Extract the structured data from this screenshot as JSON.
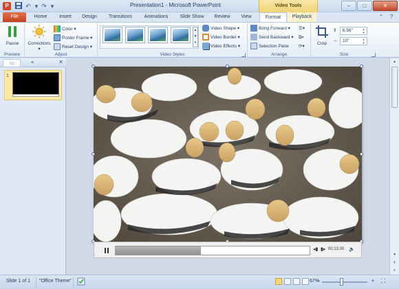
{
  "window": {
    "title": "Presentation1 - Microsoft PowerPoint",
    "context_group": "Video Tools",
    "minimize": "–",
    "maximize": "□",
    "close": "✕"
  },
  "tabs": [
    "File",
    "Home",
    "Insert",
    "Design",
    "Transitions",
    "Animations",
    "Slide Show",
    "Review",
    "View",
    "Format",
    "Playback"
  ],
  "active_tab": "Format",
  "ribbon": {
    "preview": {
      "pause_label": "Pause",
      "group_label": "Preview"
    },
    "adjust": {
      "corrections_label": "Corrections",
      "color_label": "Color",
      "poster_frame_label": "Poster Frame",
      "reset_design_label": "Reset Design",
      "group_label": "Adjust"
    },
    "video_styles": {
      "video_shape_label": "Video Shape",
      "video_border_label": "Video Border",
      "video_effects_label": "Video Effects",
      "group_label": "Video Styles"
    },
    "arrange": {
      "bring_forward_label": "Bring Forward",
      "send_backward_label": "Send Backward",
      "selection_pane_label": "Selection Pane",
      "group_label": "Arrange"
    },
    "size": {
      "crop_label": "Crop",
      "height_value": "6.56\"",
      "width_value": "10\"",
      "group_label": "Size"
    }
  },
  "slides_pane": {
    "slide_number": "1"
  },
  "player": {
    "time": "00:13.00",
    "progress_fraction": 0.44
  },
  "status": {
    "slide_info": "Slide 1 of 1",
    "theme": "\"Office Theme\"",
    "zoom": "67%"
  },
  "colors": {
    "file_tab": "#c2421f",
    "context_tab": "#f0d273",
    "pause_icon": "#2fa33a"
  }
}
